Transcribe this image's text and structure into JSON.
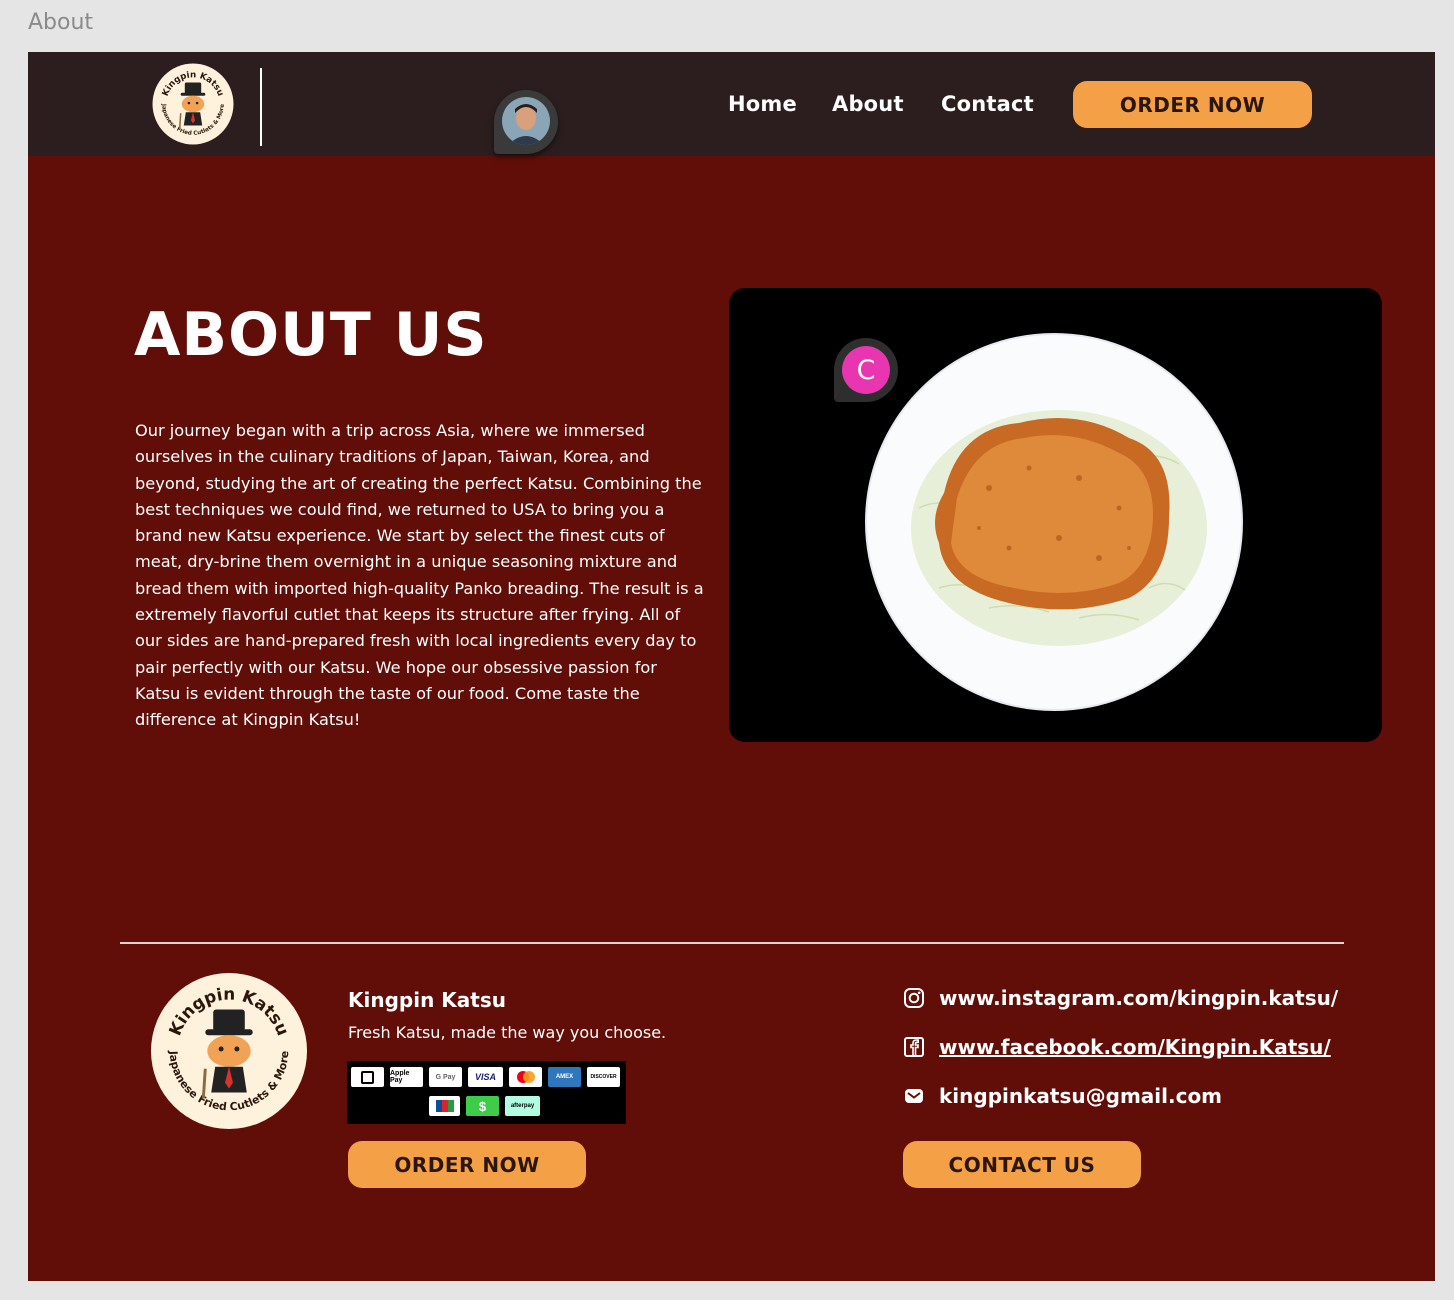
{
  "frame_label": "About",
  "header": {
    "nav": [
      "Home",
      "About",
      "Contact"
    ],
    "order_button": "ORDER NOW"
  },
  "about": {
    "title": "ABOUT US",
    "body": "Our journey began with a trip across Asia, where we immersed ourselves in the culinary traditions of Japan, Taiwan, Korea, and beyond, studying the art of creating the perfect Katsu. Combining the best techniques we could find, we returned to USA to bring you a brand new Katsu experience. We start by select the finest cuts of meat, dry-brine them overnight in a unique seasoning mixture and bread them with imported high-quality Panko breading. The result is a extremely flavorful cutlet that keeps its structure after frying. All of our sides are hand-prepared fresh with local ingredients every day to pair perfectly with our Katsu. We hope our obsessive passion for Katsu is evident through the taste of our food. Come taste the difference at Kingpin Katsu!",
    "comment_initial": "C"
  },
  "logo": {
    "top_text": "Kingpin Katsu",
    "bottom_text": "Japanese Fried Cutlets & More"
  },
  "footer": {
    "brand": "Kingpin Katsu",
    "tagline": "Fresh Katsu, made the way you choose.",
    "payments": [
      "Square",
      "Apple Pay",
      "G Pay",
      "VISA",
      "Mastercard",
      "AMEX",
      "DISCOVER",
      "JCB",
      "Cash App",
      "afterpay"
    ],
    "order_button": "ORDER NOW",
    "contact_button": "CONTACT US",
    "instagram": "www.instagram.com/kingpin.katsu/",
    "facebook": "www.facebook.com/Kingpin.Katsu/",
    "email": "kingpinkatsu@gmail.com"
  },
  "colors": {
    "background": "#620e08",
    "header": "#2c1e1e",
    "accent": "#f4a046",
    "comment_badge": "#e835b0"
  }
}
